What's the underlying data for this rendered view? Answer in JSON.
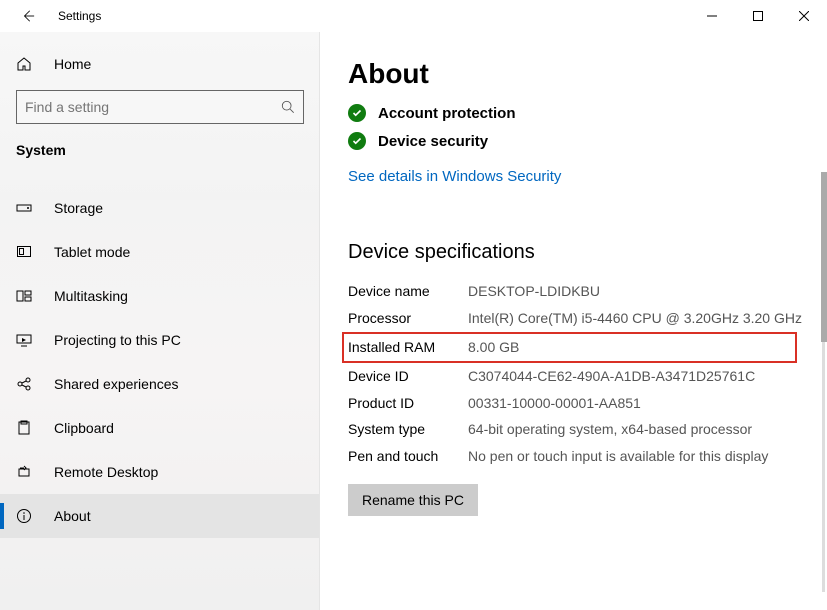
{
  "window": {
    "title": "Settings"
  },
  "sidebar": {
    "home_label": "Home",
    "search_placeholder": "Find a setting",
    "group": "System",
    "items": [
      {
        "label": "Storage"
      },
      {
        "label": "Tablet mode"
      },
      {
        "label": "Multitasking"
      },
      {
        "label": "Projecting to this PC"
      },
      {
        "label": "Shared experiences"
      },
      {
        "label": "Clipboard"
      },
      {
        "label": "Remote Desktop"
      },
      {
        "label": "About"
      }
    ]
  },
  "main": {
    "title": "About",
    "status": [
      "Account protection",
      "Device security"
    ],
    "security_link": "See details in Windows Security",
    "spec_title": "Device specifications",
    "specs": [
      {
        "k": "Device name",
        "v": "DESKTOP-LDIDKBU"
      },
      {
        "k": "Processor",
        "v": "Intel(R) Core(TM) i5-4460  CPU @ 3.20GHz   3.20 GHz"
      },
      {
        "k": "Installed RAM",
        "v": "8.00 GB"
      },
      {
        "k": "Device ID",
        "v": "C3074044-CE62-490A-A1DB-A3471D25761C"
      },
      {
        "k": "Product ID",
        "v": "00331-10000-00001-AA851"
      },
      {
        "k": "System type",
        "v": "64-bit operating system, x64-based processor"
      },
      {
        "k": "Pen and touch",
        "v": "No pen or touch input is available for this display"
      }
    ],
    "rename_label": "Rename this PC"
  }
}
